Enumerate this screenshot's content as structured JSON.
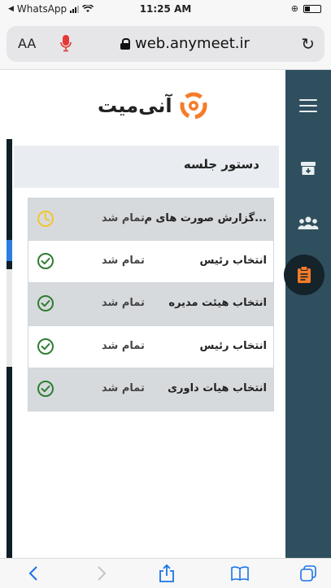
{
  "status_bar": {
    "back_app": "WhatsApp",
    "time": "11:25 AM"
  },
  "browser": {
    "text_size_label": "AA",
    "url": "web.anymeet.ir"
  },
  "app": {
    "logo_text": "آنی‌میت",
    "accent_color": "#f57c29"
  },
  "panel": {
    "title": "دستور جلسه"
  },
  "agenda_items": [
    {
      "title": "گزارش صورت های م...",
      "status": "تمام شد",
      "icon": "clock-icon",
      "icon_color": "#f4c430"
    },
    {
      "title": "انتخاب رئیس",
      "status": "تمام شد",
      "icon": "check-circle-icon",
      "icon_color": "#2e7d32"
    },
    {
      "title": "انتخاب هیئت مدیره",
      "status": "تمام شد",
      "icon": "check-circle-icon",
      "icon_color": "#2e7d32"
    },
    {
      "title": "انتخاب رئیس",
      "status": "تمام شد",
      "icon": "check-circle-icon",
      "icon_color": "#2e7d32"
    },
    {
      "title": "انتخاب هیات داوری",
      "status": "تمام شد",
      "icon": "check-circle-icon",
      "icon_color": "#2e7d32"
    }
  ],
  "sidebar": {
    "items": [
      "menu-icon",
      "archive-icon",
      "users-icon",
      "clipboard-icon"
    ],
    "active": "clipboard-icon",
    "color": "#2f4f5e"
  }
}
